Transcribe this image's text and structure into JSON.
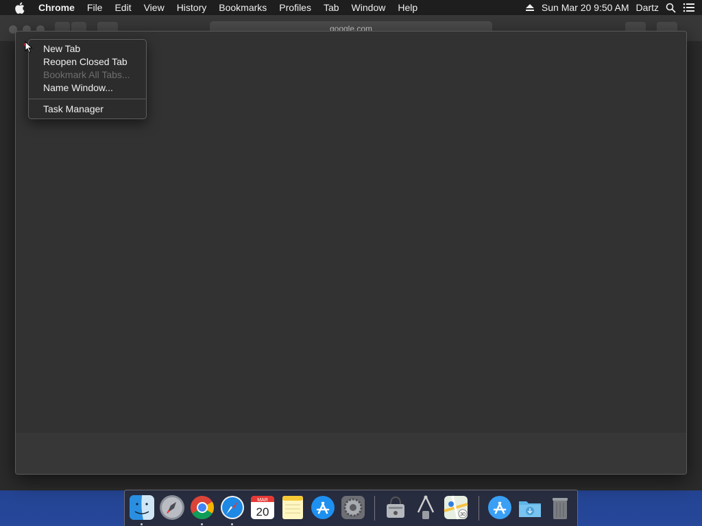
{
  "menubar": {
    "app_name": "Chrome",
    "items": [
      "File",
      "Edit",
      "View",
      "History",
      "Bookmarks",
      "Profiles",
      "Tab",
      "Window",
      "Help"
    ],
    "clock": "Sun Mar 20  9:50 AM",
    "user": "Dartz"
  },
  "browser": {
    "url": "google.com"
  },
  "context_menu": {
    "new_tab": "New Tab",
    "reopen_closed_tab": "Reopen Closed Tab",
    "bookmark_all_tabs": "Bookmark All Tabs...",
    "name_window": "Name Window...",
    "task_manager": "Task Manager"
  },
  "dock": {
    "calendar_month": "MAR",
    "calendar_day": "20",
    "maps_badge": "30",
    "apps": [
      "finder-icon",
      "launchpad-icon",
      "chrome-icon",
      "safari-icon",
      "calendar-icon",
      "notes-icon",
      "app-store-icon",
      "system-preferences-icon",
      "disk-utility-icon",
      "system-information-icon",
      "maps-icon",
      "app-store-folder-icon",
      "downloads-folder-icon",
      "trash-icon"
    ]
  },
  "colors": {
    "menubar_bg": "#1e1e1e",
    "window_bg": "#323232",
    "menu_bg": "#2c2c2c",
    "disabled_text": "#6e6e6e"
  }
}
